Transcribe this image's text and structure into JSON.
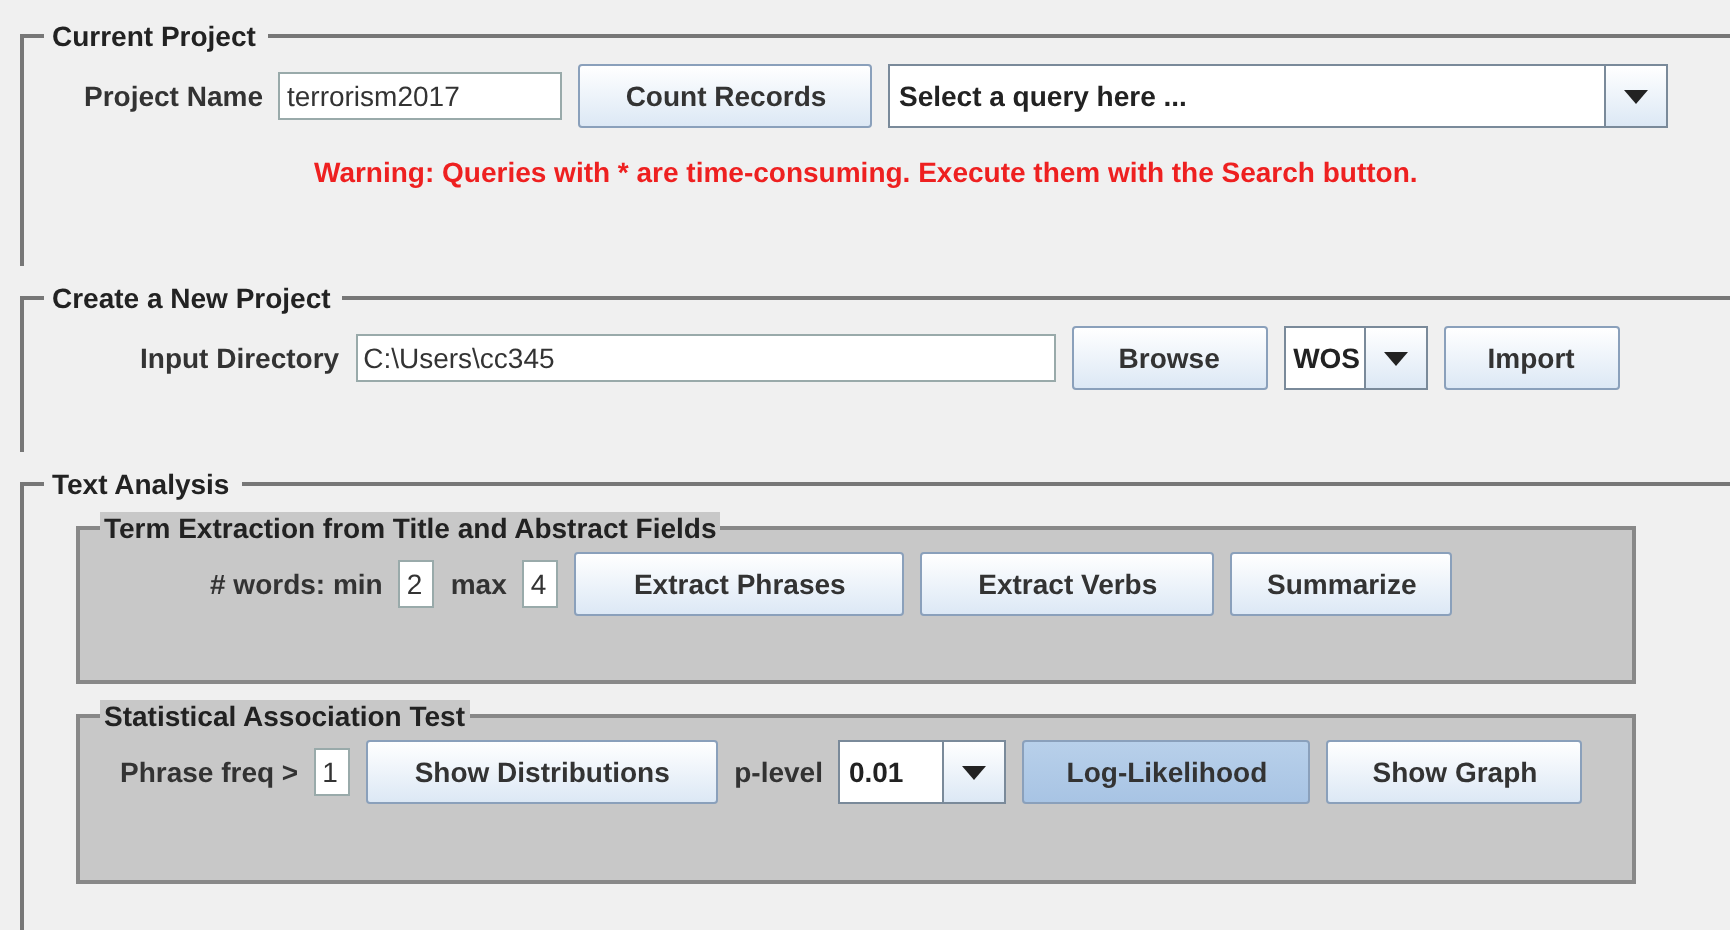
{
  "current_project": {
    "title": "Current Project",
    "project_name_label": "Project Name",
    "project_name": "terrorism2017",
    "count_button": "Count Records",
    "query_select": "Select a query here ...",
    "warning": "Warning: Queries with * are time-consuming. Execute them with the Search button."
  },
  "new_project": {
    "title": "Create a New Project",
    "input_label": "Input Directory",
    "input_directory": "C:\\Users\\cc345",
    "browse_button": "Browse",
    "format_select": "WOS",
    "import_button": "Import"
  },
  "text_analysis": {
    "title": "Text Analysis",
    "term_extraction": {
      "title": "Term Extraction from Title and Abstract Fields",
      "words_min_label": "# words: min",
      "min": "2",
      "max_label": "max",
      "max": "4",
      "buttons": [
        {
          "label": "Extract Phrases",
          "focused": false
        },
        {
          "label": "Extract Verbs",
          "focused": false
        },
        {
          "label": "Summarize",
          "focused": false
        }
      ]
    },
    "association_test": {
      "title": "Statistical Association Test",
      "freq_label": "Phrase freq >",
      "freq": "1",
      "distributions_button": "Show Distributions",
      "p_level_label": "p-level",
      "p_level": "0.01",
      "buttons": [
        {
          "label": "Log-Likelihood",
          "focused": true
        },
        {
          "label": "Show Graph",
          "focused": false
        }
      ]
    }
  }
}
